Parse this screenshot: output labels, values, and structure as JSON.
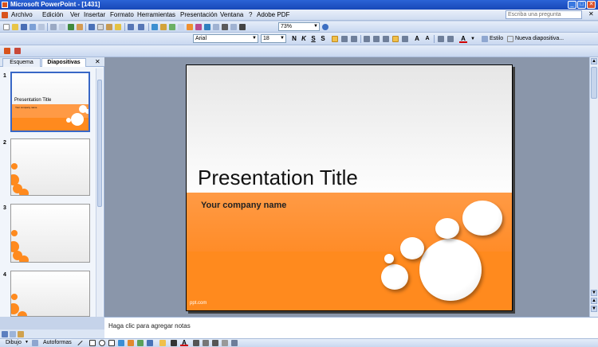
{
  "window": {
    "title": "Microsoft PowerPoint - [1431]"
  },
  "menu": {
    "items": [
      "Archivo",
      "Edición",
      "Ver",
      "Insertar",
      "Formato",
      "Herramientas",
      "Presentación",
      "Ventana",
      "?",
      "Adobe PDF"
    ],
    "help_placeholder": "Escriba una pregunta"
  },
  "toolbar": {
    "zoom": "73%",
    "font_name": "Arial",
    "font_size": "18",
    "bold": "N",
    "italic": "K",
    "underline": "S",
    "shadow": "S",
    "style_button": "Estilo",
    "new_slide_button": "Nueva diapositiva..."
  },
  "panel": {
    "tabs": [
      "Esquema",
      "Diapositivas"
    ],
    "active_tab": "Diapositivas",
    "slide_numbers": [
      "1",
      "2",
      "3",
      "4"
    ],
    "thumb1_title": "Presentation Title",
    "thumb1_company": "Your company name"
  },
  "slide": {
    "title": "Presentation Title",
    "company": "Your company name",
    "footer": "ppt.com"
  },
  "notes": {
    "placeholder": "Haga clic para agregar notas"
  },
  "drawing": {
    "draw_label": "Dibujo",
    "autoshapes_label": "Autoformas"
  },
  "colors": {
    "accent_orange": "#ff8a1e",
    "selection_blue": "#3867c6",
    "titlebar_blue": "#1848b8"
  }
}
